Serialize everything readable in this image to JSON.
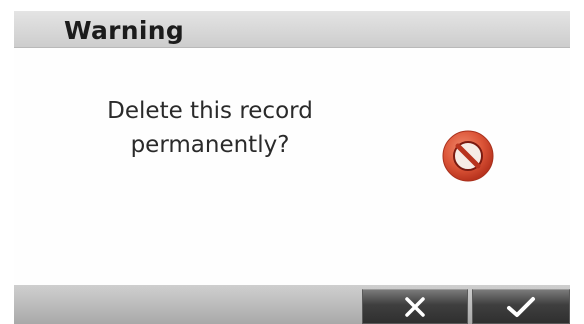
{
  "dialog": {
    "title": "Warning",
    "message_line1": "Delete this record",
    "message_line2": "permanently?",
    "icon": "prohibited-icon"
  },
  "buttons": {
    "cancel_icon": "close-icon",
    "confirm_icon": "checkmark-icon"
  },
  "colors": {
    "warning_icon": "#d9503a",
    "title_bar": "#d8d8d8",
    "button": "#3f3f3f"
  }
}
